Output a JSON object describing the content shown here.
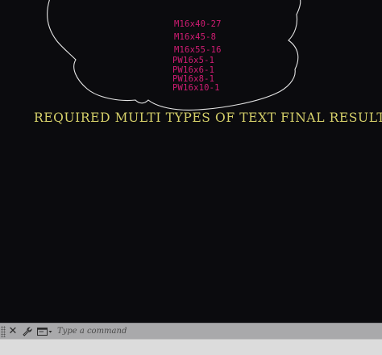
{
  "drawing": {
    "text_items": [
      "M16x40-27",
      "M16x45-8",
      "M16x55-16",
      "PW16x5-1",
      "PW16x6-1",
      "PW16x8-1",
      "PW16x10-1"
    ],
    "main_label": "REQUIRED MULTI TYPES OF TEXT FINAL RESULT",
    "colors": {
      "background": "#0b0b0e",
      "cloud_stroke": "#e6e6e6",
      "text_magenta": "#d21c74",
      "label_yellow": "#d6d06a"
    }
  },
  "command_line": {
    "placeholder": "Type a command",
    "close_icon": "close-icon",
    "customize_icon": "wrench-icon",
    "recent_icon": "recent-commands-icon"
  }
}
